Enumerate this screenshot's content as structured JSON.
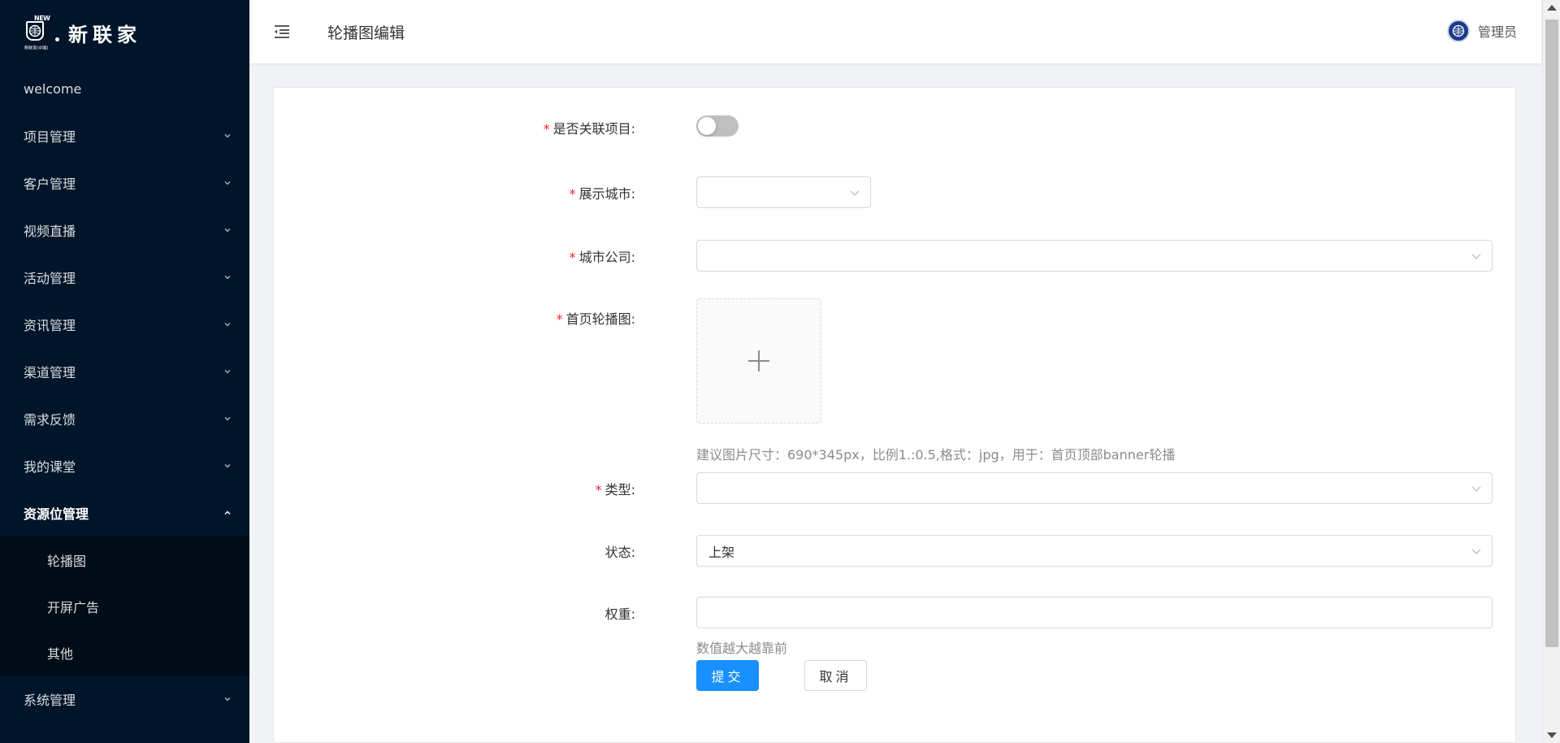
{
  "brand": {
    "logo_badge": "NEW",
    "logo_sub": "新联家(中国)",
    "name": "新联家"
  },
  "sidebar": {
    "items": [
      {
        "label": "welcome"
      },
      {
        "label": "项目管理"
      },
      {
        "label": "客户管理"
      },
      {
        "label": "视频直播"
      },
      {
        "label": "活动管理"
      },
      {
        "label": "资讯管理"
      },
      {
        "label": "渠道管理"
      },
      {
        "label": "需求反馈"
      },
      {
        "label": "我的课堂"
      },
      {
        "label": "资源位管理"
      },
      {
        "label": "系统管理"
      }
    ],
    "submenu": [
      {
        "label": "轮播图"
      },
      {
        "label": "开屏广告"
      },
      {
        "label": "其他"
      }
    ]
  },
  "header": {
    "title": "轮播图编辑",
    "user": "管理员"
  },
  "form": {
    "link_project_label": "是否关联项目:",
    "city_label": "展示城市:",
    "city_value": "",
    "company_label": "城市公司:",
    "company_value": "",
    "banner_label": "首页轮播图:",
    "banner_hint": "建议图片尺寸：690*345px，比例1.:0.5,格式：jpg，用于：首页顶部banner轮播",
    "type_label": "类型:",
    "type_value": "",
    "status_label": "状态:",
    "status_value": "上架",
    "weight_label": "权重:",
    "weight_value": "",
    "weight_hint": "数值越大越靠前",
    "submit_label": "提交",
    "cancel_label": "取消"
  },
  "icons": {
    "fold": "menu-fold-icon",
    "chevron": "chevron-down-icon",
    "plus": "plus-icon"
  },
  "colors": {
    "sidebar_bg": "#001529",
    "submenu_bg": "#000c17",
    "primary": "#1890ff",
    "required": "#f5222d"
  }
}
